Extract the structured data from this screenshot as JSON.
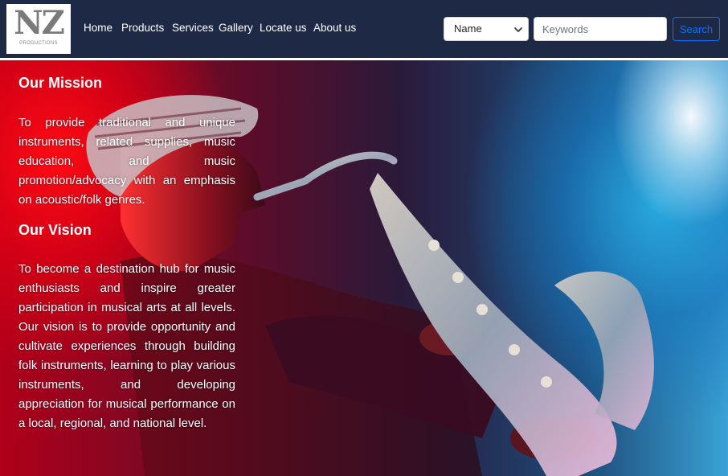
{
  "brand": {
    "logo_text": "NZ",
    "logo_subtext": "PRODUCTIONS"
  },
  "nav": {
    "links": [
      "Home",
      "Products",
      "Services",
      "Gallery",
      "Locate us",
      "About us"
    ]
  },
  "search": {
    "select_value": "Name",
    "input_placeholder": "Keywords",
    "input_value": "",
    "button_label": "Search"
  },
  "mission": {
    "heading": "Our Mission",
    "text": "To provide traditional and unique instruments, related supplies, music education, and music promotion/advocacy with an emphasis on acoustic/folk genres."
  },
  "vision": {
    "heading": "Our Vision",
    "text": "To become a destination hub for music enthusiasts and inspire greater participation in musical arts at all levels. Our vision is to provide opportunity and cultivate experiences through building folk instruments, learning to play various instruments, and developing appreciation for musical performance on a local, regional, and national level."
  },
  "hero_image": {
    "subject": "saxophone-player"
  },
  "colors": {
    "navbar_bg": "#1e2a45",
    "accent": "#0d6efd",
    "logo_text": "#7a7a7a",
    "hero_red": "#e00014",
    "hero_blue": "#2aa0dc"
  }
}
